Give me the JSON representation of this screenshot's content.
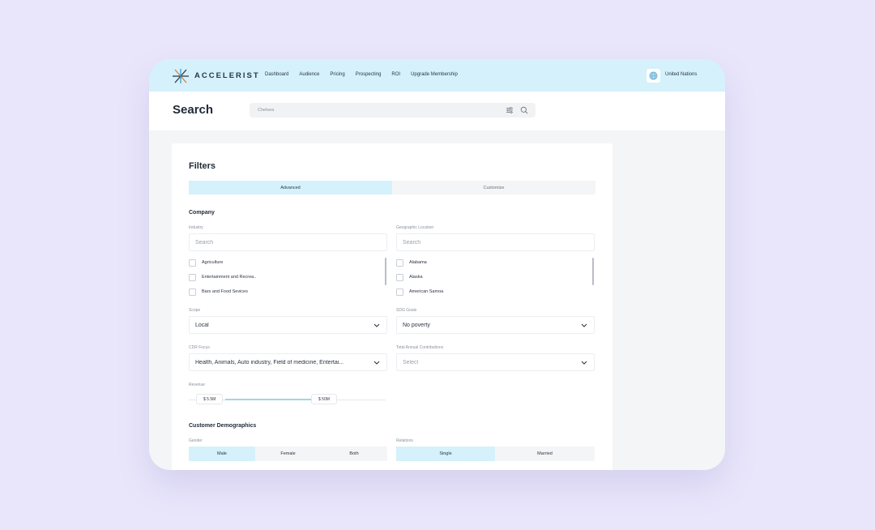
{
  "brand": {
    "name": "ACCELERIST"
  },
  "nav": [
    "Dashboard",
    "Audience",
    "Pricing",
    "Prospecting",
    "ROI",
    "Upgrade Membership"
  ],
  "org": {
    "name": "United Nations"
  },
  "page": {
    "title": "Search"
  },
  "search": {
    "placeholder": "Chelsea"
  },
  "filters": {
    "title": "Filters",
    "tabs": [
      {
        "label": "Advanced",
        "active": true
      },
      {
        "label": "Customize",
        "active": false
      }
    ]
  },
  "company": {
    "title": "Company",
    "industry": {
      "label": "Industry",
      "placeholder": "Search",
      "options": [
        "Agriculture",
        "Entertainment and Recrea..",
        "Bars and Food Sevices"
      ]
    },
    "location": {
      "label": "Geographic Location",
      "placeholder": "Search",
      "options": [
        "Alabama",
        "Alaska",
        "American Samoa"
      ]
    },
    "scope": {
      "label": "Scope",
      "value": "Local"
    },
    "sdg": {
      "label": "SDG Goals",
      "value": "No poverty"
    },
    "cdr": {
      "label": "CDR Focus",
      "value": "Health, Animals, Auto industry, Field of medicine, Entertai..."
    },
    "contributions": {
      "label": "Total Annual Contributions",
      "value": "Select"
    },
    "revenue": {
      "label": "Revenue",
      "min": "$ 5.5M",
      "max": "$ 50M"
    }
  },
  "demographics": {
    "title": "Customer Demographics",
    "gender": {
      "label": "Gender",
      "options": [
        {
          "label": "Male",
          "active": true
        },
        {
          "label": "Female",
          "active": false
        },
        {
          "label": "Both",
          "active": false
        }
      ]
    },
    "relations": {
      "label": "Relations",
      "options": [
        {
          "label": "Single",
          "active": true
        },
        {
          "label": "Married",
          "active": false
        }
      ]
    }
  },
  "colors": {
    "accent": "#d4f1fc",
    "background": "#e9e6fb",
    "text": "#1f2a37"
  }
}
